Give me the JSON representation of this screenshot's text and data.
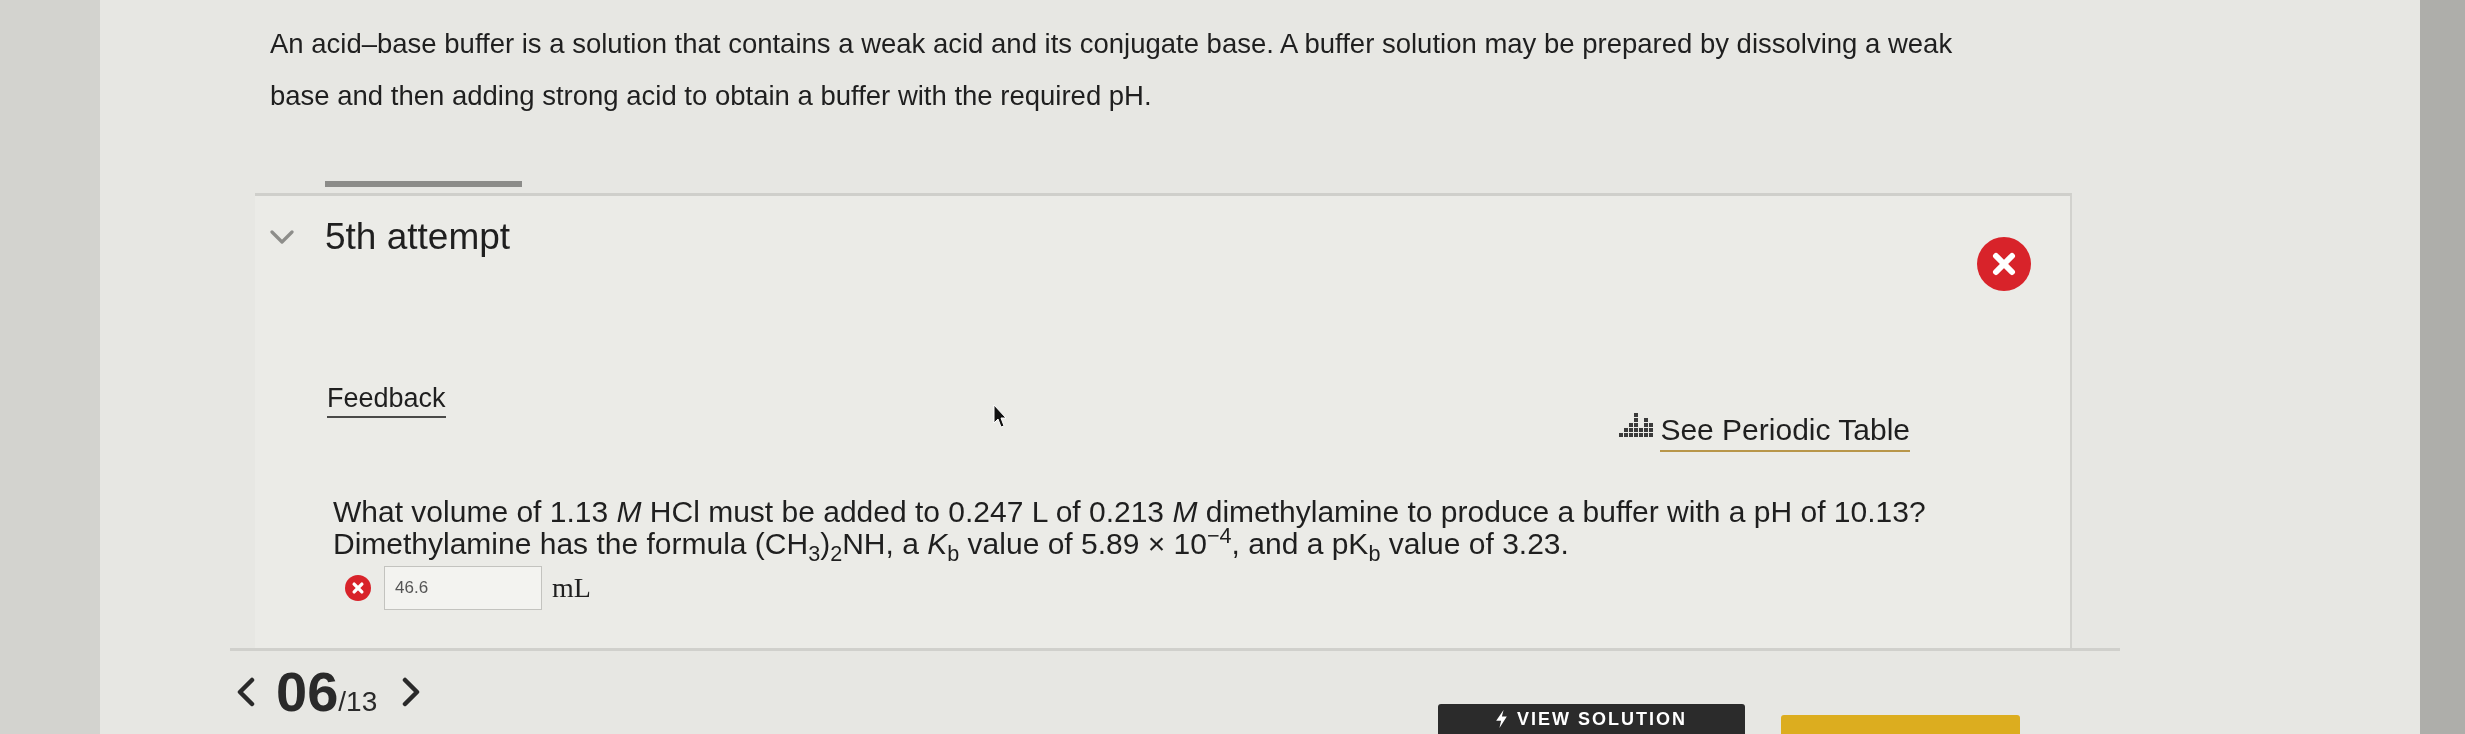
{
  "intro": "An acid–base buffer is a solution that contains a weak acid and its conjugate base. A buffer solution may be prepared by dissolving a weak base and then adding strong acid to obtain a buffer with the required pH.",
  "attempt": {
    "label": "5th attempt",
    "expanded": true,
    "correct": false
  },
  "links": {
    "feedback": "Feedback",
    "periodic_table": "See Periodic Table"
  },
  "question": {
    "lines": [
      "What volume of 1.13 *M* HCl must be added to 0.247 L of 0.213 *M* dimethylamine to produce a buffer with a pH of 10.13?",
      "Dimethylamine has the formula (CH$_{3}$)$_{2}$NH, a *K*$_{b}$ value of 5.89 × 10$^{−4}$, and a pK$_{b}$ value of 3.23."
    ],
    "answer": {
      "value": "46.6",
      "unit": "mL",
      "correct": false
    }
  },
  "pager": {
    "current": "06",
    "total": "/13"
  },
  "buttons": [
    {
      "kind": "solution",
      "label": "VIEW SOLUTION"
    },
    {
      "kind": "primary"
    }
  ]
}
